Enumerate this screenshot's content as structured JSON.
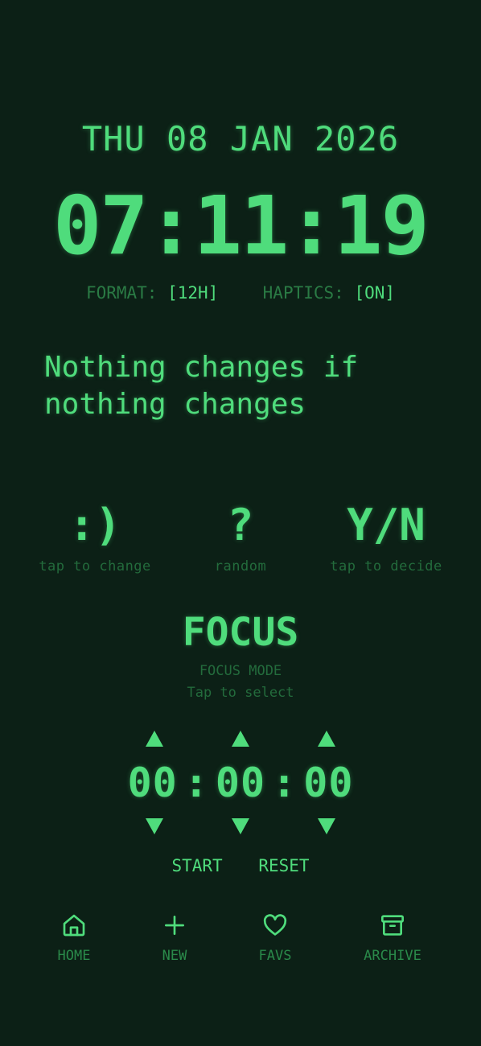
{
  "header": {
    "date": "THU 08 JAN 2026",
    "time": "07:11:19"
  },
  "settings": {
    "format_label": "FORMAT:",
    "format_value": "[12H]",
    "haptics_label": "HAPTICS:",
    "haptics_value": "[ON]"
  },
  "quote": "Nothing changes if nothing changes",
  "tools": [
    {
      "symbol": ":)",
      "caption": "tap to change"
    },
    {
      "symbol": "?",
      "caption": "random"
    },
    {
      "symbol": "Y/N",
      "caption": "tap to decide"
    }
  ],
  "focus": {
    "title": "FOCUS",
    "mode": "FOCUS MODE",
    "hint": "Tap to select"
  },
  "timer": {
    "hours": "00",
    "minutes": "00",
    "seconds": "00",
    "separator": ":",
    "start_label": "START",
    "reset_label": "RESET"
  },
  "nav": [
    {
      "label": "HOME",
      "icon": "home-icon"
    },
    {
      "label": "NEW",
      "icon": "plus-icon"
    },
    {
      "label": "FAVS",
      "icon": "heart-icon"
    },
    {
      "label": "ARCHIVE",
      "icon": "archive-icon"
    }
  ],
  "colors": {
    "background": "#0c2016",
    "accent": "#4fdc7c",
    "dim": "#236b3c"
  }
}
